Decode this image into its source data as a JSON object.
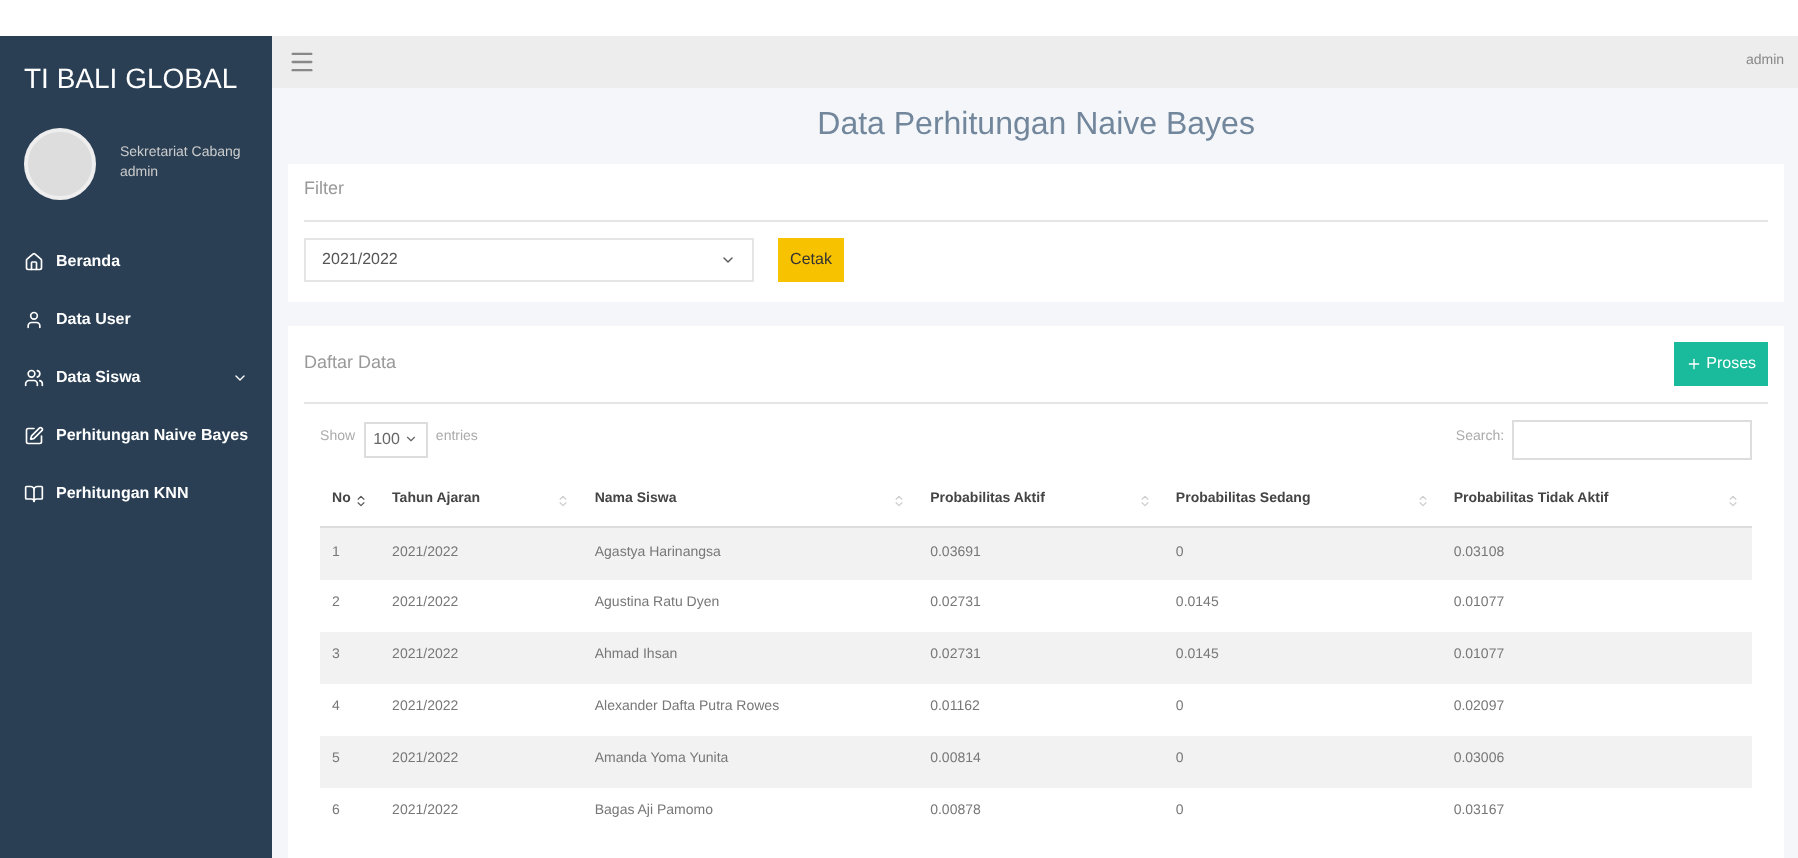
{
  "brand": "TI BALI GLOBAL",
  "user": {
    "name": "Sekretariat Cabang",
    "role": "admin"
  },
  "sidebar": {
    "items": [
      {
        "label": "Beranda",
        "kind": "home",
        "expandable": false
      },
      {
        "label": "Data User",
        "kind": "user",
        "expandable": false
      },
      {
        "label": "Data Siswa",
        "kind": "users",
        "expandable": true
      },
      {
        "label": "Perhitungan Naive Bayes",
        "kind": "edit",
        "expandable": false
      },
      {
        "label": "Perhitungan KNN",
        "kind": "book",
        "expandable": false
      }
    ]
  },
  "topbar": {
    "user": "admin"
  },
  "page_title": "Data Perhitungan Naive Bayes",
  "filter": {
    "title": "Filter",
    "select_value": "2021/2022",
    "print_button": "Cetak"
  },
  "list": {
    "title": "Daftar Data",
    "process_button": "Proses",
    "show_label": "Show",
    "page_size": "100",
    "entries_label": "entries",
    "search_label": "Search:"
  },
  "table": {
    "columns": [
      {
        "label": "No",
        "sorted": true
      },
      {
        "label": "Tahun Ajaran",
        "sorted": false
      },
      {
        "label": "Nama Siswa",
        "sorted": false
      },
      {
        "label": "Probabilitas Aktif",
        "sorted": false
      },
      {
        "label": "Probabilitas Sedang",
        "sorted": false
      },
      {
        "label": "Probabilitas Tidak Aktif",
        "sorted": false
      }
    ],
    "rows": [
      [
        "1",
        "2021/2022",
        "Agastya Harinangsa",
        "0.03691",
        "0",
        "0.03108"
      ],
      [
        "2",
        "2021/2022",
        "Agustina Ratu Dyen",
        "0.02731",
        "0.0145",
        "0.01077"
      ],
      [
        "3",
        "2021/2022",
        "Ahmad Ihsan",
        "0.02731",
        "0.0145",
        "0.01077"
      ],
      [
        "4",
        "2021/2022",
        "Alexander Dafta Putra Rowes",
        "0.01162",
        "0",
        "0.02097"
      ],
      [
        "5",
        "2021/2022",
        "Amanda Yoma Yunita",
        "0.00814",
        "0",
        "0.03006"
      ],
      [
        "6",
        "2021/2022",
        "Bagas Aji Pamomo",
        "0.00878",
        "0",
        "0.03167"
      ]
    ]
  }
}
